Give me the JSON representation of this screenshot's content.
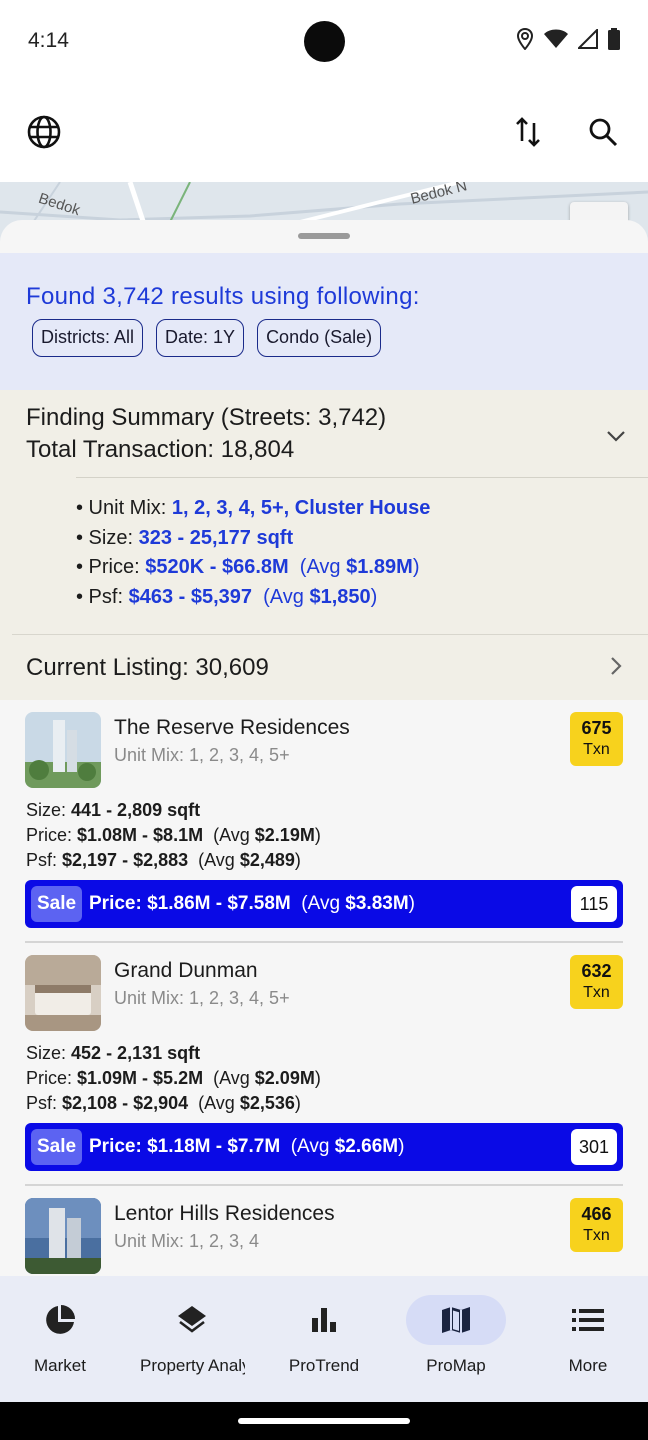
{
  "status": {
    "time": "4:14"
  },
  "map": {
    "labels": [
      "Bedok N",
      "Bedok"
    ]
  },
  "found": {
    "title": "Found 3,742 results using following:",
    "chips": [
      "Districts: All",
      "Date: 1Y",
      "Condo (Sale)"
    ]
  },
  "summary": {
    "line1": "Finding Summary (Streets: 3,742)",
    "line2": "Total Transaction: 18,804",
    "unit_mix_label": "• Unit Mix: ",
    "unit_mix": "1, 2, 3, 4, 5+, Cluster House",
    "size_label": "• Size: ",
    "size": "323 - 25,177 sqft",
    "price_label": "• Price: ",
    "price": "$520K - $66.8M",
    "price_avg_pre": "(Avg ",
    "price_avg": "$1.89M",
    "price_avg_post": ")",
    "psf_label": "• Psf: ",
    "psf": "$463 - $5,397",
    "psf_avg_pre": "(Avg ",
    "psf_avg": "$1,850",
    "psf_avg_post": ")",
    "listing": "Current Listing: 30,609"
  },
  "cards": [
    {
      "name": "The Reserve Residences",
      "unit_mix": "Unit Mix: 1, 2, 3, 4, 5+",
      "txn_count": "675",
      "txn_label": "Txn",
      "size_label": "Size: ",
      "size": "441 - 2,809 sqft",
      "price_label": "Price: ",
      "price": "$1.08M - $8.1M",
      "price_avg_pre": "  (Avg ",
      "price_avg": "$2.19M",
      "price_avg_post": ")",
      "psf_label": "Psf: ",
      "psf": "$2,197 - $2,883",
      "psf_avg_pre": "  (Avg ",
      "psf_avg": "$2,489",
      "psf_avg_post": ")",
      "sale_tag": "Sale",
      "sale_price": "Price: $1.86M - $7.58M",
      "sale_avg": "(Avg ",
      "sale_avg_value": "$3.83M",
      "sale_avg_post": ")",
      "sale_count": "115"
    },
    {
      "name": "Grand Dunman",
      "unit_mix": "Unit Mix: 1, 2, 3, 4, 5+",
      "txn_count": "632",
      "txn_label": "Txn",
      "size_label": "Size: ",
      "size": "452 - 2,131 sqft",
      "price_label": "Price: ",
      "price": "$1.09M - $5.2M",
      "price_avg_pre": "  (Avg ",
      "price_avg": "$2.09M",
      "price_avg_post": ")",
      "psf_label": "Psf: ",
      "psf": "$2,108 - $2,904",
      "psf_avg_pre": "  (Avg ",
      "psf_avg": "$2,536",
      "psf_avg_post": ")",
      "sale_tag": "Sale",
      "sale_price": "Price: $1.18M - $7.7M",
      "sale_avg": "(Avg ",
      "sale_avg_value": "$2.66M",
      "sale_avg_post": ")",
      "sale_count": "301"
    },
    {
      "name": "Lentor Hills Residences",
      "unit_mix": "Unit Mix: 1, 2, 3, 4",
      "txn_count": "466",
      "txn_label": "Txn"
    }
  ],
  "nav": {
    "items": [
      {
        "label": "Market",
        "icon": "pie-chart-icon"
      },
      {
        "label": "Property Analysis",
        "icon": "layers-icon"
      },
      {
        "label": "ProTrend",
        "icon": "bar-chart-icon"
      },
      {
        "label": "ProMap",
        "icon": "map-icon",
        "active": true
      },
      {
        "label": "More",
        "icon": "list-icon"
      }
    ]
  },
  "colors": {
    "accent_blue": "#1e3ad8",
    "sale_bar": "#0a0ae6",
    "txn_badge": "#f7d21d",
    "found_bg": "#e5e9f8",
    "summary_bg": "#f1efe7"
  }
}
